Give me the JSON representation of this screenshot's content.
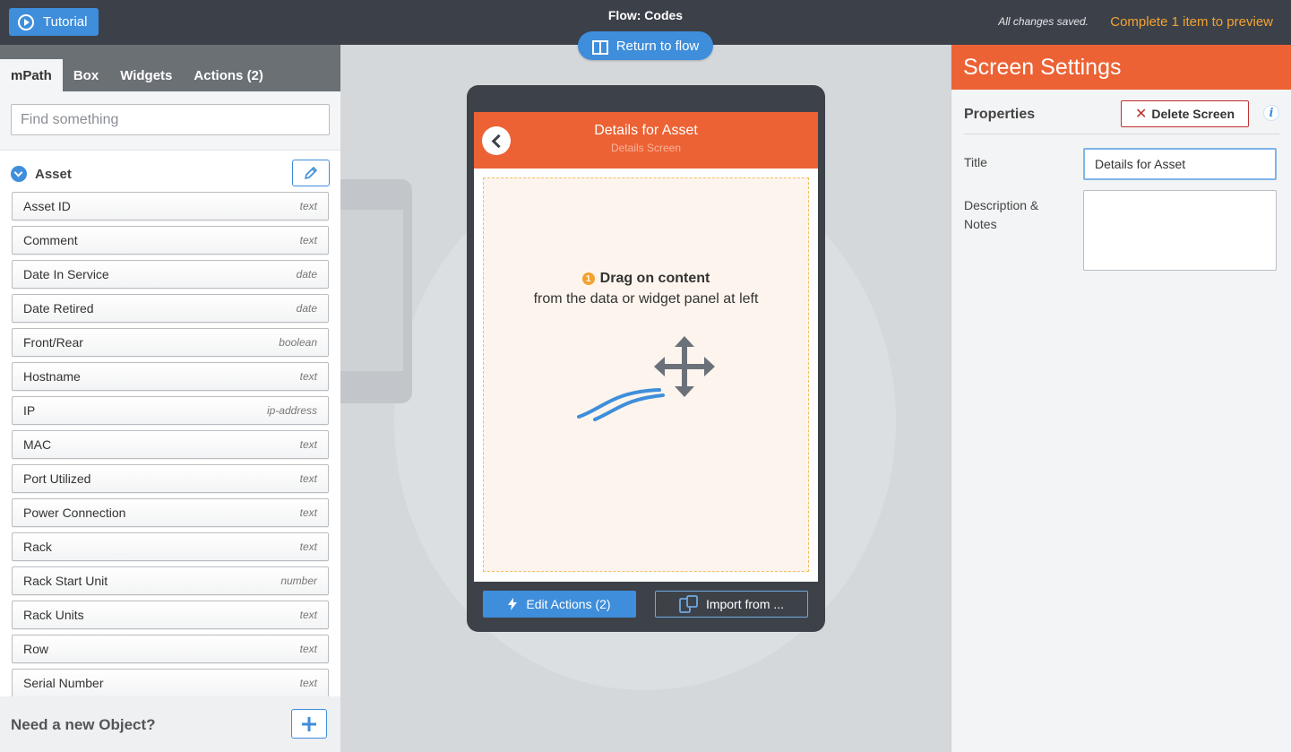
{
  "topbar": {
    "tutorial_label": "Tutorial",
    "flow_title": "Flow: Codes",
    "save_status": "All changes saved.",
    "preview_link": "Complete 1 item to preview",
    "return_label": "Return to flow"
  },
  "left_panel": {
    "tabs": [
      {
        "label": "mPath"
      },
      {
        "label": "Box"
      },
      {
        "label": "Widgets"
      },
      {
        "label": "Actions (2)"
      }
    ],
    "search_placeholder": "Find something",
    "object_name": "Asset",
    "fields": [
      {
        "name": "Asset ID",
        "type": "text"
      },
      {
        "name": "Comment",
        "type": "text"
      },
      {
        "name": "Date In Service",
        "type": "date"
      },
      {
        "name": "Date Retired",
        "type": "date"
      },
      {
        "name": "Front/Rear",
        "type": "boolean"
      },
      {
        "name": "Hostname",
        "type": "text"
      },
      {
        "name": "IP",
        "type": "ip-address"
      },
      {
        "name": "MAC",
        "type": "text"
      },
      {
        "name": "Port Utilized",
        "type": "text"
      },
      {
        "name": "Power Connection",
        "type": "text"
      },
      {
        "name": "Rack",
        "type": "text"
      },
      {
        "name": "Rack Start Unit",
        "type": "number"
      },
      {
        "name": "Rack Units",
        "type": "text"
      },
      {
        "name": "Row",
        "type": "text"
      },
      {
        "name": "Serial Number",
        "type": "text"
      }
    ],
    "new_object_label": "Need a new Object?"
  },
  "canvas": {
    "screen_title": "Details for Asset",
    "screen_subtitle": "Details Screen",
    "dropzone_step": "1",
    "dropzone_title": "Drag on content",
    "dropzone_hint": "from the data or widget panel at left",
    "edit_actions_label": "Edit Actions (2)",
    "import_label": "Import from ..."
  },
  "right_panel": {
    "heading": "Screen Settings",
    "properties_label": "Properties",
    "delete_label": "Delete Screen",
    "info_glyph": "i",
    "title_label": "Title",
    "title_value": "Details for Asset",
    "description_label": "Description & Notes",
    "description_value": ""
  },
  "colors": {
    "topbar": "#3c4149",
    "accent_blue": "#3f8edb",
    "brand_orange": "#ec6234",
    "preview_orange": "#f3a230",
    "delete_red": "#c32f2f"
  }
}
